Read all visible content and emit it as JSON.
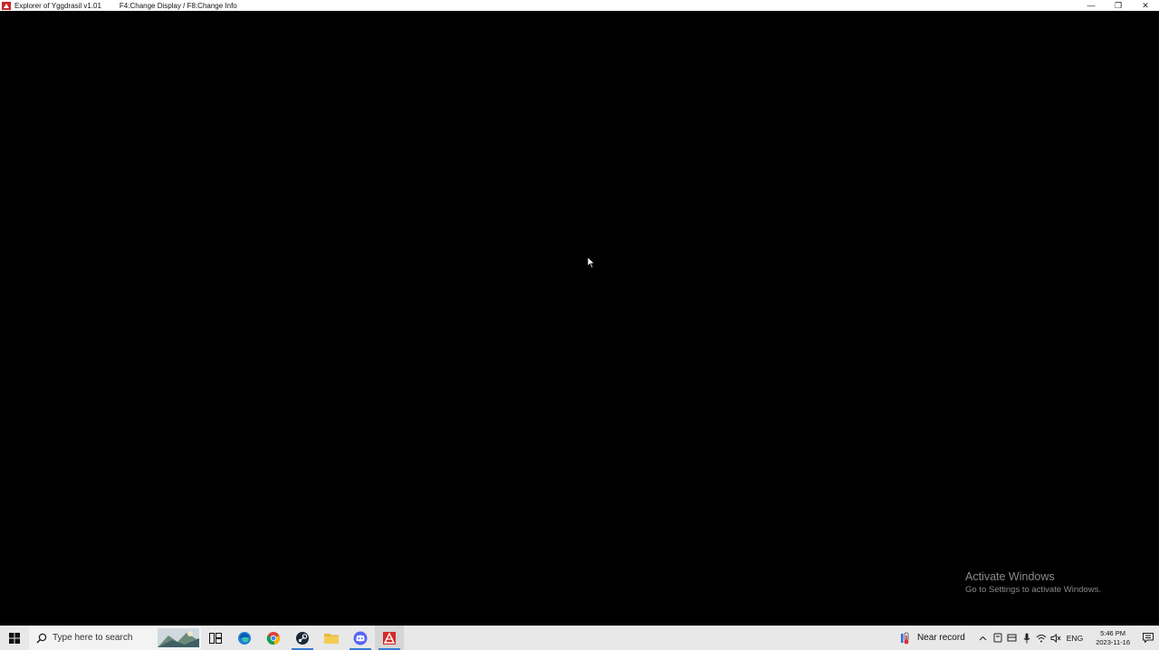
{
  "window": {
    "title": "Explorer of Yggdrasil v1.01",
    "hint": "F4:Change Display / F8:Change Info",
    "controls": {
      "minimize": "—",
      "restore": "❐",
      "close": "✕"
    }
  },
  "watermark": {
    "title": "Activate Windows",
    "subtitle": "Go to Settings to activate Windows."
  },
  "taskbar": {
    "search_placeholder": "Type here to search",
    "apps": [
      {
        "name": "task-view",
        "icon": "task-view-icon"
      },
      {
        "name": "edge",
        "icon": "edge-icon"
      },
      {
        "name": "chrome",
        "icon": "chrome-icon"
      },
      {
        "name": "steam",
        "icon": "steam-icon"
      },
      {
        "name": "file-explorer",
        "icon": "folder-icon"
      },
      {
        "name": "discord",
        "icon": "discord-icon"
      },
      {
        "name": "explorer-of-yggdrasil",
        "icon": "game-icon"
      }
    ],
    "weather_text": "Near record",
    "language": "ENG",
    "time": "5:46 PM",
    "date": "2023-11-16"
  },
  "colors": {
    "taskbar_bg": "#e8e8e8",
    "accent": "#3a7bd5",
    "game_red": "#d42a2a"
  }
}
